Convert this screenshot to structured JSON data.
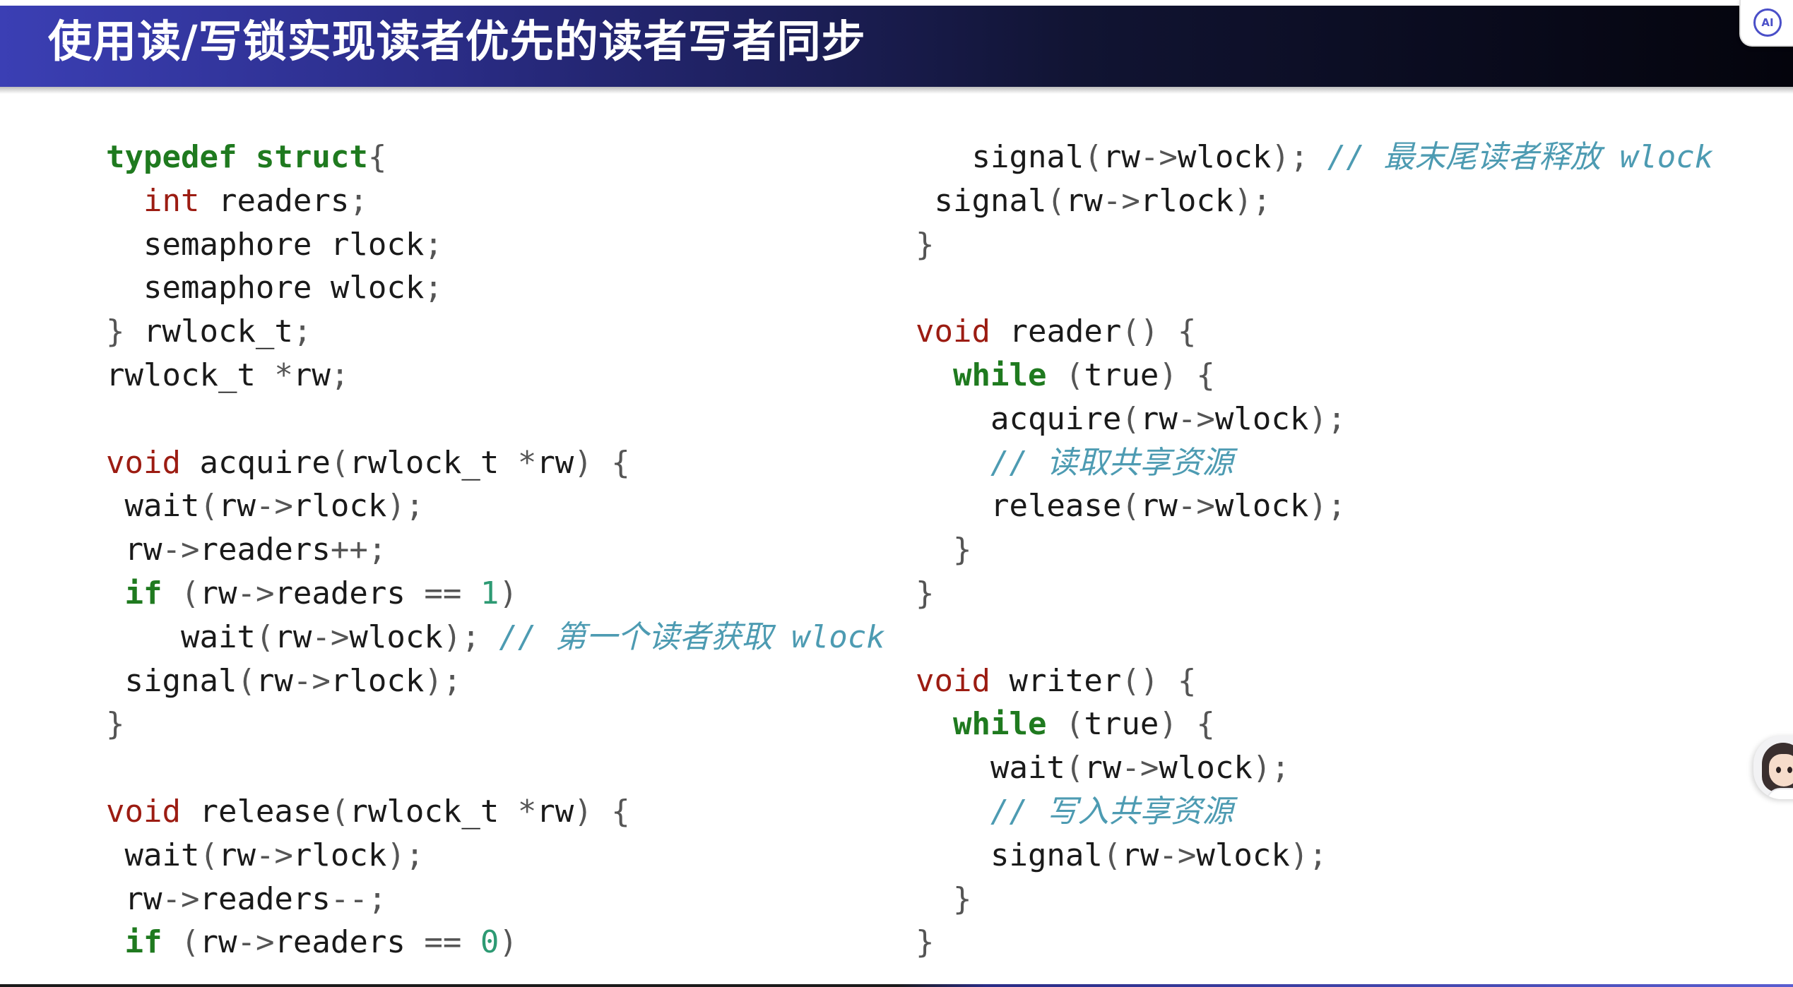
{
  "slide": {
    "title": "使用读/写锁实现读者优先的读者写者同步"
  },
  "badge": {
    "icon": "ai-assistant-icon",
    "label": "AI"
  },
  "avatar": {
    "icon": "assistant-avatar-icon"
  },
  "code": {
    "left": [
      [
        {
          "t": "typedef struct",
          "c": "kw-green"
        },
        {
          "t": "{",
          "c": "punc"
        }
      ],
      [
        {
          "t": "  "
        },
        {
          "t": "int",
          "c": "kw-red"
        },
        {
          "t": " readers"
        },
        {
          "t": ";",
          "c": "punc"
        }
      ],
      [
        {
          "t": "  semaphore rlock"
        },
        {
          "t": ";",
          "c": "punc"
        }
      ],
      [
        {
          "t": "  semaphore wlock"
        },
        {
          "t": ";",
          "c": "punc"
        }
      ],
      [
        {
          "t": "}",
          "c": "punc"
        },
        {
          "t": " rwlock_t"
        },
        {
          "t": ";",
          "c": "punc"
        }
      ],
      [
        {
          "t": "rwlock_t "
        },
        {
          "t": "*",
          "c": "punc"
        },
        {
          "t": "rw"
        },
        {
          "t": ";",
          "c": "punc"
        }
      ],
      [
        {
          "t": ""
        }
      ],
      [
        {
          "t": "void",
          "c": "kw-red"
        },
        {
          "t": " acquire"
        },
        {
          "t": "(",
          "c": "punc"
        },
        {
          "t": "rwlock_t "
        },
        {
          "t": "*",
          "c": "punc"
        },
        {
          "t": "rw"
        },
        {
          "t": ") {",
          "c": "punc"
        }
      ],
      [
        {
          "t": " wait"
        },
        {
          "t": "(",
          "c": "punc"
        },
        {
          "t": "rw"
        },
        {
          "t": "->",
          "c": "punc"
        },
        {
          "t": "rlock"
        },
        {
          "t": ");",
          "c": "punc"
        }
      ],
      [
        {
          "t": " rw"
        },
        {
          "t": "->",
          "c": "punc"
        },
        {
          "t": "readers"
        },
        {
          "t": "++;",
          "c": "punc"
        }
      ],
      [
        {
          "t": " "
        },
        {
          "t": "if",
          "c": "kw-green"
        },
        {
          "t": " (",
          "c": "punc"
        },
        {
          "t": "rw"
        },
        {
          "t": "->",
          "c": "punc"
        },
        {
          "t": "readers "
        },
        {
          "t": "==",
          "c": "punc"
        },
        {
          "t": " "
        },
        {
          "t": "1",
          "c": "num"
        },
        {
          "t": ")",
          "c": "punc"
        }
      ],
      [
        {
          "t": "    wait"
        },
        {
          "t": "(",
          "c": "punc"
        },
        {
          "t": "rw"
        },
        {
          "t": "->",
          "c": "punc"
        },
        {
          "t": "wlock"
        },
        {
          "t": ");",
          "c": "punc"
        },
        {
          "t": " "
        },
        {
          "t": "// 第一个读者获取 wlock",
          "c": "cmt"
        }
      ],
      [
        {
          "t": " signal"
        },
        {
          "t": "(",
          "c": "punc"
        },
        {
          "t": "rw"
        },
        {
          "t": "->",
          "c": "punc"
        },
        {
          "t": "rlock"
        },
        {
          "t": ");",
          "c": "punc"
        }
      ],
      [
        {
          "t": "}",
          "c": "punc"
        }
      ],
      [
        {
          "t": ""
        }
      ],
      [
        {
          "t": "void",
          "c": "kw-red"
        },
        {
          "t": " release"
        },
        {
          "t": "(",
          "c": "punc"
        },
        {
          "t": "rwlock_t "
        },
        {
          "t": "*",
          "c": "punc"
        },
        {
          "t": "rw"
        },
        {
          "t": ") {",
          "c": "punc"
        }
      ],
      [
        {
          "t": " wait"
        },
        {
          "t": "(",
          "c": "punc"
        },
        {
          "t": "rw"
        },
        {
          "t": "->",
          "c": "punc"
        },
        {
          "t": "rlock"
        },
        {
          "t": ");",
          "c": "punc"
        }
      ],
      [
        {
          "t": " rw"
        },
        {
          "t": "->",
          "c": "punc"
        },
        {
          "t": "readers"
        },
        {
          "t": "--;",
          "c": "punc"
        }
      ],
      [
        {
          "t": " "
        },
        {
          "t": "if",
          "c": "kw-green"
        },
        {
          "t": " (",
          "c": "punc"
        },
        {
          "t": "rw"
        },
        {
          "t": "->",
          "c": "punc"
        },
        {
          "t": "readers "
        },
        {
          "t": "==",
          "c": "punc"
        },
        {
          "t": " "
        },
        {
          "t": "0",
          "c": "num"
        },
        {
          "t": ")",
          "c": "punc"
        }
      ]
    ],
    "right": [
      [
        {
          "t": "   signal"
        },
        {
          "t": "(",
          "c": "punc"
        },
        {
          "t": "rw"
        },
        {
          "t": "->",
          "c": "punc"
        },
        {
          "t": "wlock"
        },
        {
          "t": ");",
          "c": "punc"
        },
        {
          "t": " "
        },
        {
          "t": "// 最末尾读者释放 wlock",
          "c": "cmt"
        }
      ],
      [
        {
          "t": " signal"
        },
        {
          "t": "(",
          "c": "punc"
        },
        {
          "t": "rw"
        },
        {
          "t": "->",
          "c": "punc"
        },
        {
          "t": "rlock"
        },
        {
          "t": ");",
          "c": "punc"
        }
      ],
      [
        {
          "t": "}",
          "c": "punc"
        }
      ],
      [
        {
          "t": ""
        }
      ],
      [
        {
          "t": "void",
          "c": "kw-red"
        },
        {
          "t": " reader"
        },
        {
          "t": "() {",
          "c": "punc"
        }
      ],
      [
        {
          "t": "  "
        },
        {
          "t": "while",
          "c": "kw-green"
        },
        {
          "t": " (",
          "c": "punc"
        },
        {
          "t": "true"
        },
        {
          "t": ") {",
          "c": "punc"
        }
      ],
      [
        {
          "t": "    acquire"
        },
        {
          "t": "(",
          "c": "punc"
        },
        {
          "t": "rw"
        },
        {
          "t": "->",
          "c": "punc"
        },
        {
          "t": "wlock"
        },
        {
          "t": ");",
          "c": "punc"
        }
      ],
      [
        {
          "t": "    "
        },
        {
          "t": "// 读取共享资源",
          "c": "cmt"
        }
      ],
      [
        {
          "t": "    release"
        },
        {
          "t": "(",
          "c": "punc"
        },
        {
          "t": "rw"
        },
        {
          "t": "->",
          "c": "punc"
        },
        {
          "t": "wlock"
        },
        {
          "t": ");",
          "c": "punc"
        }
      ],
      [
        {
          "t": "  }",
          "c": "punc"
        }
      ],
      [
        {
          "t": "}",
          "c": "punc"
        }
      ],
      [
        {
          "t": ""
        }
      ],
      [
        {
          "t": "void",
          "c": "kw-red"
        },
        {
          "t": " writer"
        },
        {
          "t": "() {",
          "c": "punc"
        }
      ],
      [
        {
          "t": "  "
        },
        {
          "t": "while",
          "c": "kw-green"
        },
        {
          "t": " (",
          "c": "punc"
        },
        {
          "t": "true"
        },
        {
          "t": ") {",
          "c": "punc"
        }
      ],
      [
        {
          "t": "    wait"
        },
        {
          "t": "(",
          "c": "punc"
        },
        {
          "t": "rw"
        },
        {
          "t": "->",
          "c": "punc"
        },
        {
          "t": "wlock"
        },
        {
          "t": ");",
          "c": "punc"
        }
      ],
      [
        {
          "t": "    "
        },
        {
          "t": "// 写入共享资源",
          "c": "cmt"
        }
      ],
      [
        {
          "t": "    signal"
        },
        {
          "t": "(",
          "c": "punc"
        },
        {
          "t": "rw"
        },
        {
          "t": "->",
          "c": "punc"
        },
        {
          "t": "wlock"
        },
        {
          "t": ");",
          "c": "punc"
        }
      ],
      [
        {
          "t": "  }",
          "c": "punc"
        }
      ],
      [
        {
          "t": "}",
          "c": "punc"
        }
      ]
    ]
  }
}
